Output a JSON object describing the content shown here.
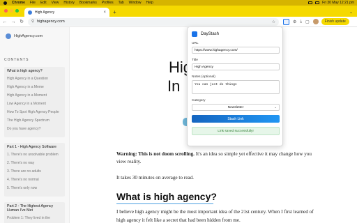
{
  "menubar": {
    "items": [
      "Chrome",
      "File",
      "Edit",
      "View",
      "History",
      "Bookmarks",
      "Profiles",
      "Tab",
      "Window",
      "Help"
    ],
    "clock": "Fri 30 May  12:21 pm"
  },
  "tab": {
    "title": "High Agency"
  },
  "toolbar": {
    "url": "highagency.com",
    "finish_update": "Finish update"
  },
  "sidebar": {
    "brand": "HighAgency.com",
    "contents_heading": "CONTENTS",
    "section1": {
      "heading": "What is high agency?",
      "items": [
        "High Agency in a Question",
        "High Agency in a Meme",
        "High Agency in a Moment",
        "Low Agency in a Moment",
        "How To Spot High Agency People",
        "The High Agency Spectrum",
        "Do you have agency?"
      ]
    },
    "section2": {
      "heading": "Part 1 - High Agency Software",
      "items": [
        "1. There's no unsolvable problem",
        "2. There's no way",
        "3. There are no adults",
        "4. There's no normal",
        "5. There's only now"
      ]
    },
    "section3": {
      "heading": "Part 2 - The Highest Agency Human I've Met",
      "items": [
        "Problem 1: They lived in the"
      ]
    }
  },
  "main": {
    "hero_line1": "Hig",
    "hero_line2": "In",
    "warning_bold": "Warning: This is not doom scrolling.",
    "warning_rest": " It's an idea so simple yet effective it may change how you view reality.",
    "read_time": "It takes 30 minutes on average to read.",
    "h2": "What is high agency?",
    "body": "I believe high agency might be the most important idea of the 21st century. When I first learned of high agency it felt like a secret that had been hidden from me."
  },
  "popup": {
    "title": "DayStash",
    "url_label": "URL",
    "url_value": "https://www.highagency.com/",
    "title_label": "Title",
    "title_value": "High Agency",
    "notes_label": "Notes (optional)",
    "notes_value": "You can just do things",
    "category_label": "Category",
    "category_value": "Newsletter",
    "stash_button": "Stash Link",
    "success": "Link saved successfully!"
  },
  "colors": {
    "menubar": "#d6b400",
    "tabstrip": "#f5d900",
    "accent": "#1a73e8",
    "success_bg": "#e6f6e9"
  }
}
